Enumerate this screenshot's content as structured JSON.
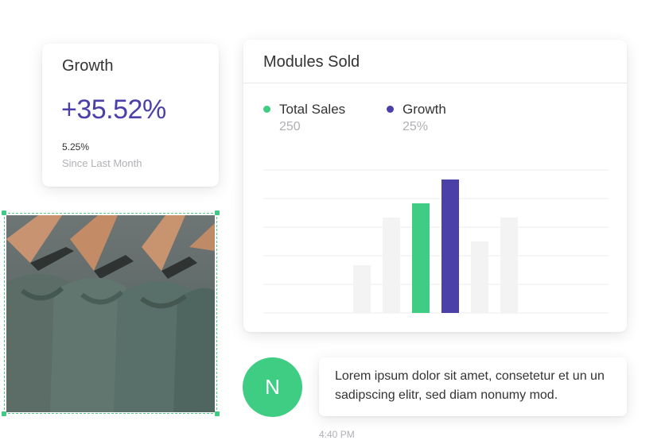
{
  "growth_card": {
    "title": "Growth",
    "value": "+35.52%",
    "change_pct": "5.25%",
    "since_label": "Since Last Month"
  },
  "modules_card": {
    "title": "Modules Sold",
    "legend": [
      {
        "label": "Total Sales",
        "value": "250",
        "color": "#3fcd83"
      },
      {
        "label": "Growth",
        "value": "25%",
        "color": "#4b3fa8"
      }
    ]
  },
  "chart_data": {
    "type": "bar",
    "categories": [
      "",
      "",
      "",
      "",
      "",
      ""
    ],
    "values": [
      20,
      40,
      46,
      56,
      30,
      40
    ],
    "colors": [
      "#f3f3f4",
      "#f3f3f4",
      "#3fcd83",
      "#4b3fa8",
      "#f3f3f4",
      "#f3f3f4"
    ],
    "ylim": [
      0,
      60
    ],
    "grid": true,
    "title": "",
    "xlabel": "",
    "ylabel": ""
  },
  "message": {
    "avatar_initial": "N",
    "text": "Lorem ipsum dolor sit amet, consetetur et un un sadipscing elitr, sed diam nonumy mod.",
    "time": "4:40 PM"
  },
  "colors": {
    "accent_purple": "#4b3fa8",
    "accent_green": "#3fcd83",
    "muted_text": "#b0b0b5"
  }
}
